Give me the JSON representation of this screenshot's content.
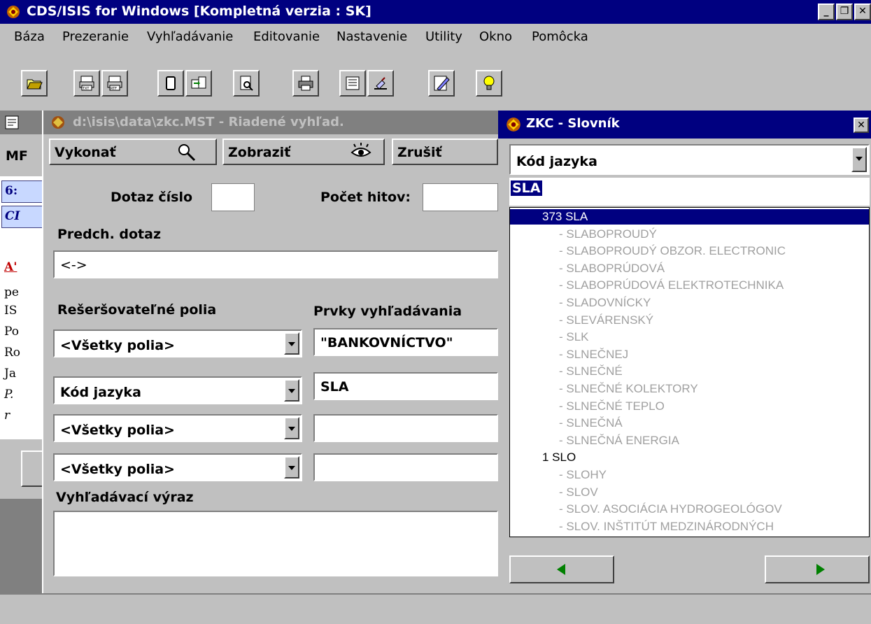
{
  "app": {
    "title": "CDS/ISIS for Windows [Kompletná verzia : SK]",
    "caption_buttons": [
      "_",
      "⧉",
      "✕"
    ]
  },
  "menu": [
    "Báza",
    "Prezeranie",
    "Vyhľadávanie",
    "Editovanie",
    "Nastavenie",
    "Utility",
    "Okno",
    "Pomôcka"
  ],
  "toolbar_icons": [
    "open-folder-icon",
    "print-txt-icon",
    "print-rtf-icon",
    "copy-icon",
    "export-icon",
    "preview-icon",
    "printer-icon",
    "form-icon",
    "stamp-icon",
    "edit-pencil-icon",
    "lightbulb-icon"
  ],
  "background_window": {
    "header": "MF",
    "rows": [
      "6:",
      "CI",
      "A'",
      "pe",
      "IS",
      "Po",
      "Ro",
      "Ja",
      "P.",
      "r"
    ]
  },
  "search": {
    "title": "d:\\isis\\data\\zkc.MST - Riadené vyhľad.",
    "execute_label": "Vykonať",
    "show_label": "Zobraziť",
    "cancel_label": "Zrušiť",
    "query_number_label": "Dotaz číslo",
    "query_number_value": "",
    "hits_label": "Počet hitov:",
    "hits_value": "",
    "prev_query_label": "Predch. dotaz",
    "prev_query_value": "<->",
    "fields_header": "Rešeršovateľné polia",
    "elements_header": "Prvky vyhľadávania",
    "rows": [
      {
        "field": "<Všetky polia>",
        "term": "\"BANKOVNÍCTVO\""
      },
      {
        "field": "Kód jazyka",
        "term": "SLA"
      },
      {
        "field": "<Všetky polia>",
        "term": ""
      },
      {
        "field": "<Všetky polia>",
        "term": ""
      }
    ],
    "expression_label": "Vyhľadávací výraz",
    "expression_value": ""
  },
  "dictionary": {
    "title": "ZKC - Slovník",
    "field_select": "Kód jazyka",
    "search_value": "SLA",
    "terms": [
      {
        "text": "373  SLA",
        "style": "sel"
      },
      {
        "text": "- SLABOPROUDÝ",
        "style": "gray"
      },
      {
        "text": "- SLABOPROUDÝ OBZOR. ELECTRONIC",
        "style": "gray"
      },
      {
        "text": "- SLABOPRÚDOVÁ",
        "style": "gray"
      },
      {
        "text": "- SLABOPRÚDOVÁ ELEKTROTECHNIKA",
        "style": "gray"
      },
      {
        "text": "- SLADOVNÍCKY",
        "style": "gray"
      },
      {
        "text": "- SLEVÁRENSKÝ",
        "style": "gray"
      },
      {
        "text": "- SLK",
        "style": "gray"
      },
      {
        "text": "- SLNEČNEJ",
        "style": "gray"
      },
      {
        "text": "- SLNEČNÉ",
        "style": "gray"
      },
      {
        "text": "- SLNEČNÉ KOLEKTORY",
        "style": "gray"
      },
      {
        "text": "- SLNEČNÉ TEPLO",
        "style": "gray"
      },
      {
        "text": "- SLNEČNÁ",
        "style": "gray"
      },
      {
        "text": "- SLNEČNÁ ENERGIA",
        "style": "gray"
      },
      {
        "text": "1  SLO",
        "style": "normal"
      },
      {
        "text": "- SLOHY",
        "style": "gray"
      },
      {
        "text": "- SLOV",
        "style": "gray"
      },
      {
        "text": "- SLOV. ASOCIÁCIA HYDROGEOLÓGOV",
        "style": "gray"
      },
      {
        "text": "- SLOV. INŠTITÚT MEDZINÁRODNÝCH",
        "style": "gray"
      }
    ]
  },
  "colors": {
    "titlebar_active": "#000080",
    "titlebar_inactive": "#808080",
    "face": "#c0c0c0",
    "nav_arrow": "#008000",
    "red_text": "#c00000"
  }
}
